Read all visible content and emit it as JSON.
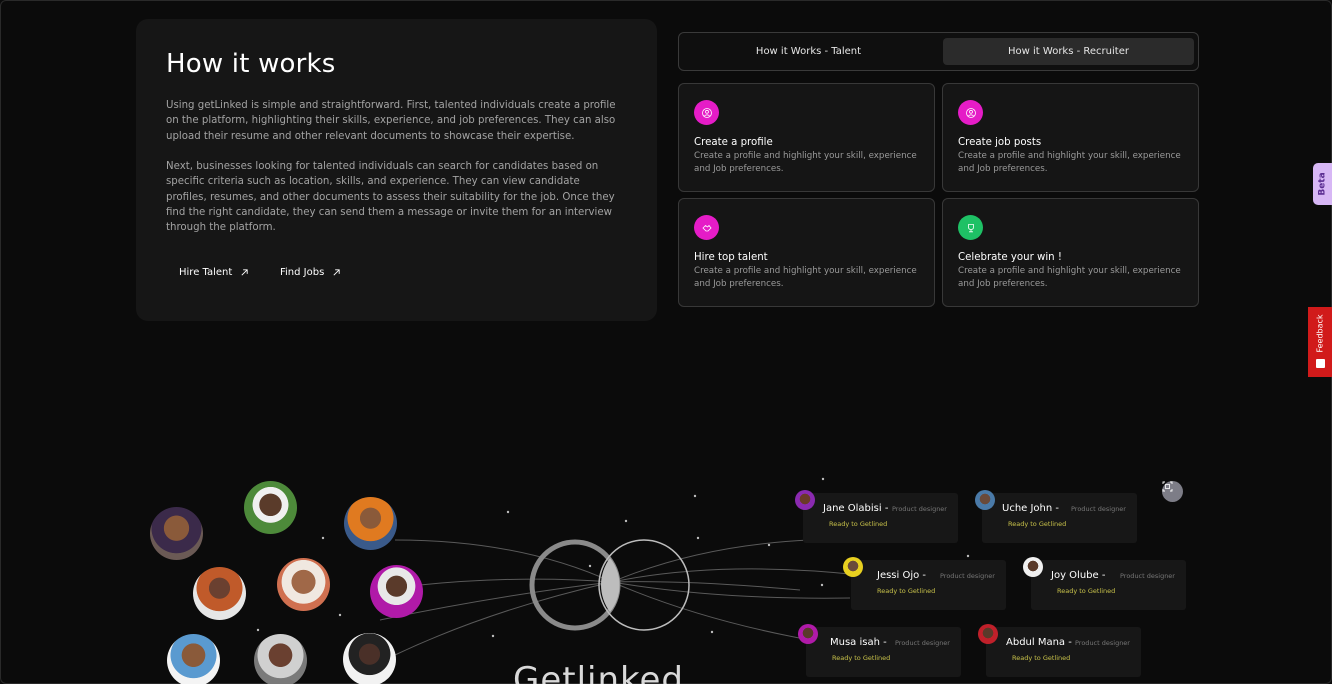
{
  "how_it_works": {
    "title": "How it works",
    "paragraph_1": "Using getLinked is simple and straightforward. First, talented individuals create a profile on the platform, highlighting their skills, experience, and job preferences. They can also upload their resume and other relevant documents to showcase their expertise.",
    "paragraph_2": "Next, businesses looking for talented individuals can search for candidates based on specific criteria such as location, skills, and experience. They can view candidate profiles, resumes, and other documents to assess their suitability for the job. Once they find the right candidate, they can send them a message or invite them for an interview through the platform.",
    "links": [
      {
        "label": "Hire Talent",
        "icon": "arrow-up-right-icon"
      },
      {
        "label": "Find Jobs",
        "icon": "arrow-up-right-icon"
      }
    ]
  },
  "tabs": [
    {
      "label": "How it Works - Talent",
      "active": false
    },
    {
      "label": "How it Works - Recruiter",
      "active": true
    }
  ],
  "steps": [
    {
      "title": "Create a profile",
      "desc": "Create a profile and highlight your skill, experience and Job preferences.",
      "icon": "profile-icon",
      "color": "#e51cc7"
    },
    {
      "title": "Create job posts",
      "desc": "Create a profile and highlight your skill, experience and Job preferences.",
      "icon": "profile-icon",
      "color": "#e51cc7"
    },
    {
      "title": "Hire top talent",
      "desc": "Create a profile and highlight your skill, experience and Job preferences.",
      "icon": "handshake-icon",
      "color": "#e51cc7"
    },
    {
      "title": "Celebrate your win !",
      "desc": "Create a profile and highlight your skill, experience and Job preferences.",
      "icon": "trophy-icon",
      "color": "#1ec165"
    }
  ],
  "side_tabs": {
    "beta": "Beta",
    "feedback": "Feedback"
  },
  "profiles": [
    {
      "name": "Jane Olabisi -",
      "role": "Product designer",
      "status": "Ready to Getlined"
    },
    {
      "name": "Uche John -",
      "role": "Product designer",
      "status": "Ready to Getlined"
    },
    {
      "name": "Jessi Ojo -",
      "role": "Product designer",
      "status": "Ready to Getlined"
    },
    {
      "name": "Joy Olube -",
      "role": "Product designer",
      "status": "Ready to Getlined"
    },
    {
      "name": "Musa isah -",
      "role": "Product designer",
      "status": "Ready to Getlined"
    },
    {
      "name": "Abdul Mana -",
      "role": "Product designer",
      "status": "Ready to Getlined"
    }
  ],
  "brand": "Getlinked"
}
